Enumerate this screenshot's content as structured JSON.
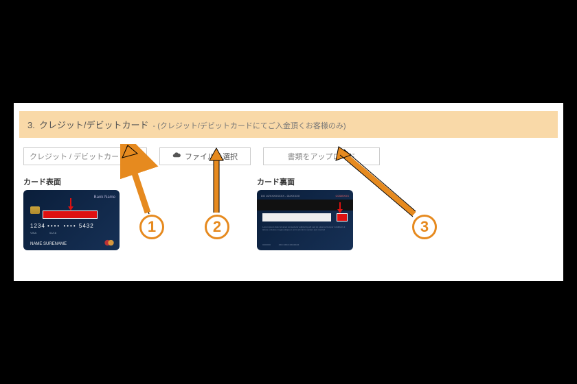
{
  "section": {
    "number": "3.",
    "title": "クレジット/デビットカード",
    "subtitle": "- (クレジット/デビットカードにてご入金頂くお客様のみ)"
  },
  "controls": {
    "select_placeholder": "クレジット / デビットカード",
    "file_button": "ファイルを選択",
    "upload_button": "書類をアップロード"
  },
  "cards": {
    "front_label": "カード表面",
    "back_label": "カード裏面",
    "front": {
      "bank": "Bank Name",
      "number_prefix": "1234",
      "number_masked": "•••• ••••",
      "number_suffix": "5432",
      "valid_label": "VISA",
      "expiry": "01/16",
      "holder": "NAME SURENAME"
    },
    "back": {
      "topline": "DO 10/XXXXXXXX - 01/XXXXX",
      "topline_right": "CODEXXX"
    }
  },
  "annotations": {
    "n1": "1",
    "n2": "2",
    "n3": "3"
  }
}
